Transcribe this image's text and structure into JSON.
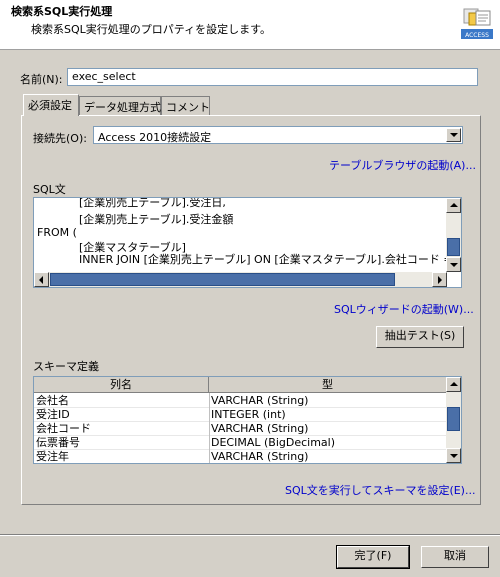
{
  "header": {
    "title": "検索系SQL実行処理",
    "description": "検索系SQL実行処理のプロパティを設定します。",
    "icon_label": "ACCESS"
  },
  "name_field": {
    "label": "名前(N):",
    "value": "exec_select"
  },
  "tabs": [
    {
      "label": "必須設定",
      "active": true
    },
    {
      "label": "データ処理方式",
      "active": false
    },
    {
      "label": "コメント",
      "active": false
    }
  ],
  "connection": {
    "label": "接続先(O):",
    "value": "Access 2010接続設定",
    "table_browser_link": "テーブルブラウザの起動(A)..."
  },
  "sql": {
    "label": "SQL文",
    "lines": [
      "            [企業別売上テーブル].受注日,",
      "            [企業別売上テーブル].受注金額",
      "FROM (",
      "            [企業マスタテーブル]",
      "            INNER JOIN [企業別売上テーブル] ON [企業マスタテーブル].会社コード = [企"
    ],
    "wizard_link": "SQLウィザードの起動(W)...",
    "extract_test_button": "抽出テスト(S)"
  },
  "schema": {
    "label": "スキーマ定義",
    "columns": [
      "列名",
      "型"
    ],
    "rows": [
      [
        "会社名",
        "VARCHAR (String)"
      ],
      [
        "受注ID",
        "INTEGER (int)"
      ],
      [
        "会社コード",
        "VARCHAR (String)"
      ],
      [
        "伝票番号",
        "DECIMAL (BigDecimal)"
      ],
      [
        "受注年",
        "VARCHAR (String)"
      ]
    ],
    "run_link": "SQL文を実行してスキーマを設定(E)..."
  },
  "footer": {
    "ok_button": "完了(F)",
    "cancel_button": "取消"
  },
  "colors": {
    "link": "#0000cc",
    "background": "#d4d0c8",
    "scroll_thumb": "#4a6fa8"
  }
}
